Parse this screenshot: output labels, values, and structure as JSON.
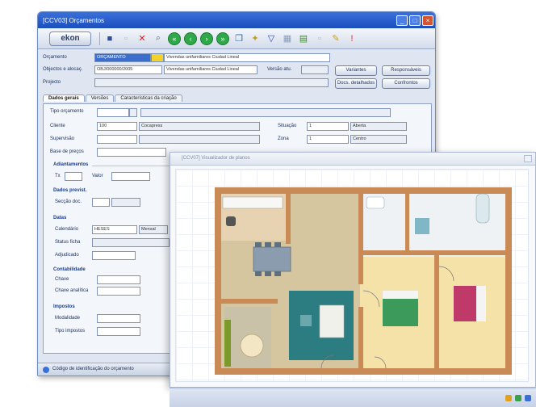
{
  "window1": {
    "title": "[CCV03] Orçamentos",
    "logo": "ekon",
    "fields": {
      "orcamento_label": "Orçamento",
      "orcamento_code": "ORÇAMENTO",
      "orcamento_desc": "Vivendas unifamiliares Ciudad Lineal",
      "objeto_label": "Objectos e alocaç.",
      "objeto_code": "OBJ/000000/2005",
      "objeto_desc": "Vivendas unifamiliares Ciudad Lineal",
      "versao_label": "Versão atu.",
      "projeto_label": "Projecto"
    },
    "buttons": {
      "variantes": "Variantes",
      "responsaveis": "Responsáveis",
      "docs": "Docs. detalhados",
      "confrontos": "Confrontos"
    },
    "tabs": [
      "Dados gerais",
      "Versões",
      "Características da criação"
    ],
    "form": {
      "tipo_label": "Tipo orçamento",
      "cliente_label": "Cliente",
      "cliente_code": "100",
      "cliente_name": "Cocapress",
      "situacao_label": "Situação",
      "situacao_code": "1",
      "situacao_value": "Aberta",
      "supervisor_label": "Supervisão",
      "zona_label": "Zona",
      "zona_code": "1",
      "zona_value": "Centro",
      "base_label": "Base de preços",
      "adiant_group": "Adiantamentos",
      "adiant_tx": "Tx",
      "adiant_valor": "Valor",
      "dados_previst": "Dados previst.",
      "seccao": "Secção doc.",
      "datas_group": "Datas",
      "calendario": "Calendário",
      "cal_value": "HESES",
      "mensal": "Mensal",
      "status_ficha": "Status ficha",
      "adjudicado": "Adjudicado",
      "contabilidade": "Contabilidade",
      "chave": "Chave",
      "chave_analitica": "Chave analítica",
      "impostos": "Impostos",
      "modalidade": "Modalidade",
      "tipo_impostos": "Tipo impostos"
    },
    "status_text": "Código de identificação do orçamento"
  },
  "window2": {
    "title": "[CCV07] Visualizador de planos"
  },
  "colors": {
    "accent": "#1b4fbf",
    "floor_wood": "#d6b58a",
    "floor_light": "#f4e7b8",
    "wall": "#c98a55",
    "rug_teal": "#2c7d82"
  }
}
